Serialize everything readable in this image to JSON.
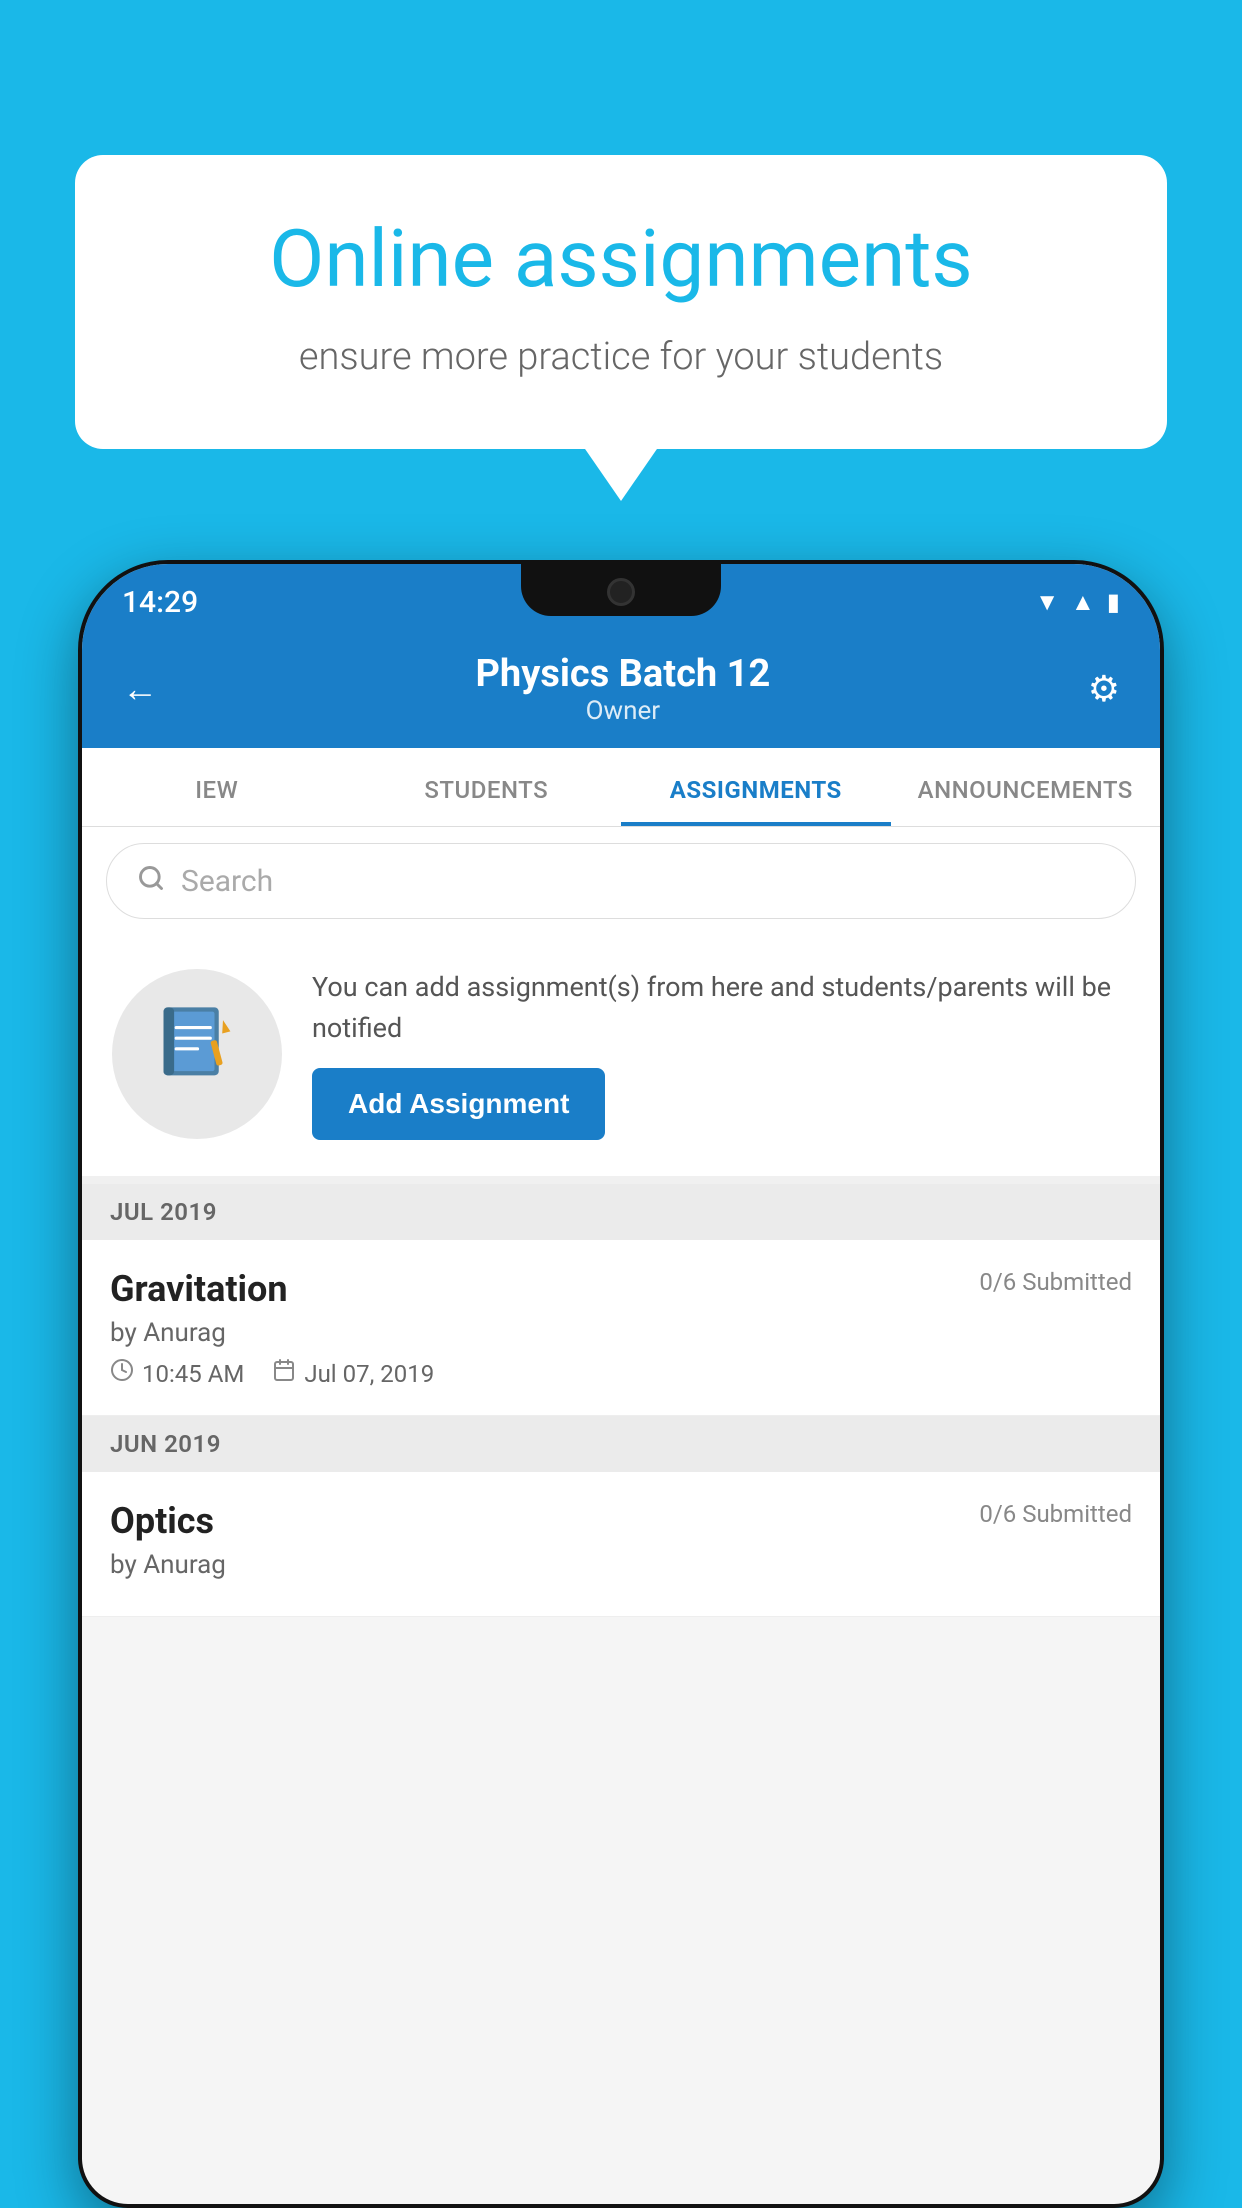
{
  "background_color": "#1ab8e8",
  "speech_bubble": {
    "title": "Online assignments",
    "subtitle": "ensure more practice for your students"
  },
  "status_bar": {
    "time": "14:29",
    "icons": [
      "wifi",
      "signal",
      "battery"
    ]
  },
  "app_header": {
    "title": "Physics Batch 12",
    "subtitle": "Owner",
    "back_label": "←",
    "settings_label": "⚙"
  },
  "tabs": [
    {
      "label": "IEW",
      "active": false
    },
    {
      "label": "STUDENTS",
      "active": false
    },
    {
      "label": "ASSIGNMENTS",
      "active": true
    },
    {
      "label": "ANNOUNCEMENTS",
      "active": false
    }
  ],
  "search": {
    "placeholder": "Search"
  },
  "promo": {
    "description": "You can add assignment(s) from here and students/parents will be notified",
    "button_label": "Add Assignment"
  },
  "sections": [
    {
      "month": "JUL 2019",
      "assignments": [
        {
          "title": "Gravitation",
          "submitted": "0/6 Submitted",
          "author": "by Anurag",
          "time": "10:45 AM",
          "date": "Jul 07, 2019"
        }
      ]
    },
    {
      "month": "JUN 2019",
      "assignments": [
        {
          "title": "Optics",
          "submitted": "0/6 Submitted",
          "author": "by Anurag",
          "time": "",
          "date": ""
        }
      ]
    }
  ]
}
